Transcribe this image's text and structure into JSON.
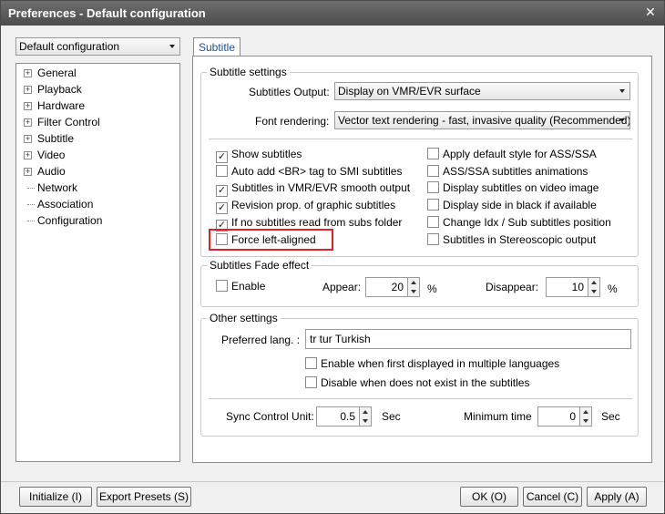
{
  "window": {
    "title": "Preferences - Default configuration"
  },
  "profile": {
    "selected": "Default configuration"
  },
  "tree": {
    "items": [
      {
        "label": "General",
        "expandable": true
      },
      {
        "label": "Playback",
        "expandable": true
      },
      {
        "label": "Hardware",
        "expandable": true
      },
      {
        "label": "Filter Control",
        "expandable": true
      },
      {
        "label": "Subtitle",
        "expandable": true
      },
      {
        "label": "Video",
        "expandable": true
      },
      {
        "label": "Audio",
        "expandable": true
      },
      {
        "label": "Network",
        "expandable": false
      },
      {
        "label": "Association",
        "expandable": false
      },
      {
        "label": "Configuration",
        "expandable": false
      }
    ]
  },
  "tab": {
    "label": "Subtitle"
  },
  "subtitle_settings": {
    "legend": "Subtitle settings",
    "output_label": "Subtitles Output:",
    "output_value": "Display on VMR/EVR surface",
    "font_label": "Font rendering:",
    "font_value": "Vector text rendering - fast, invasive quality (Recommended)"
  },
  "checks_left": [
    {
      "label": "Show subtitles",
      "checked": true
    },
    {
      "label": "Auto add <BR> tag to SMI subtitles",
      "checked": false
    },
    {
      "label": "Subtitles in VMR/EVR smooth output",
      "checked": true
    },
    {
      "label": "Revision prop. of graphic subtitles",
      "checked": true
    },
    {
      "label": "If no subtitles read from subs folder",
      "checked": true
    },
    {
      "label": "Force left-aligned",
      "checked": false
    }
  ],
  "checks_right": [
    {
      "label": "Apply default style for ASS/SSA",
      "checked": false
    },
    {
      "label": "ASS/SSA subtitles animations",
      "checked": false
    },
    {
      "label": "Display subtitles on video image",
      "checked": false
    },
    {
      "label": "Display side in black if available",
      "checked": false
    },
    {
      "label": "Change Idx / Sub subtitles position",
      "checked": false
    },
    {
      "label": "Subtitles in Stereoscopic output",
      "checked": false
    }
  ],
  "fade": {
    "legend": "Subtitles Fade effect",
    "enable_label": "Enable",
    "enable_checked": false,
    "appear_label": "Appear:",
    "appear_value": "20",
    "appear_unit": "%",
    "disappear_label": "Disappear:",
    "disappear_value": "10",
    "disappear_unit": "%"
  },
  "other": {
    "legend": "Other settings",
    "lang_label": "Preferred lang. :",
    "lang_value": "tr tur Turkish",
    "multi_label": "Enable when first displayed in multiple languages",
    "multi_checked": false,
    "disable_label": "Disable when does not exist in the subtitles",
    "disable_checked": false,
    "sync_label": "Sync Control Unit:",
    "sync_value": "0.5",
    "sync_unit": "Sec",
    "min_label": "Minimum time",
    "min_value": "0",
    "min_unit": "Sec"
  },
  "buttons": {
    "initialize": "Initialize (I)",
    "export": "Export Presets (S)",
    "ok": "OK (O)",
    "cancel": "Cancel (C)",
    "apply": "Apply (A)"
  },
  "icons": {
    "close": "close-icon",
    "check": "check-icon",
    "dropdown": "chevron-down-icon"
  },
  "colors": {
    "highlight": "#e0202a",
    "tab_text": "#1f4f9a",
    "titlebar": "#555555"
  }
}
